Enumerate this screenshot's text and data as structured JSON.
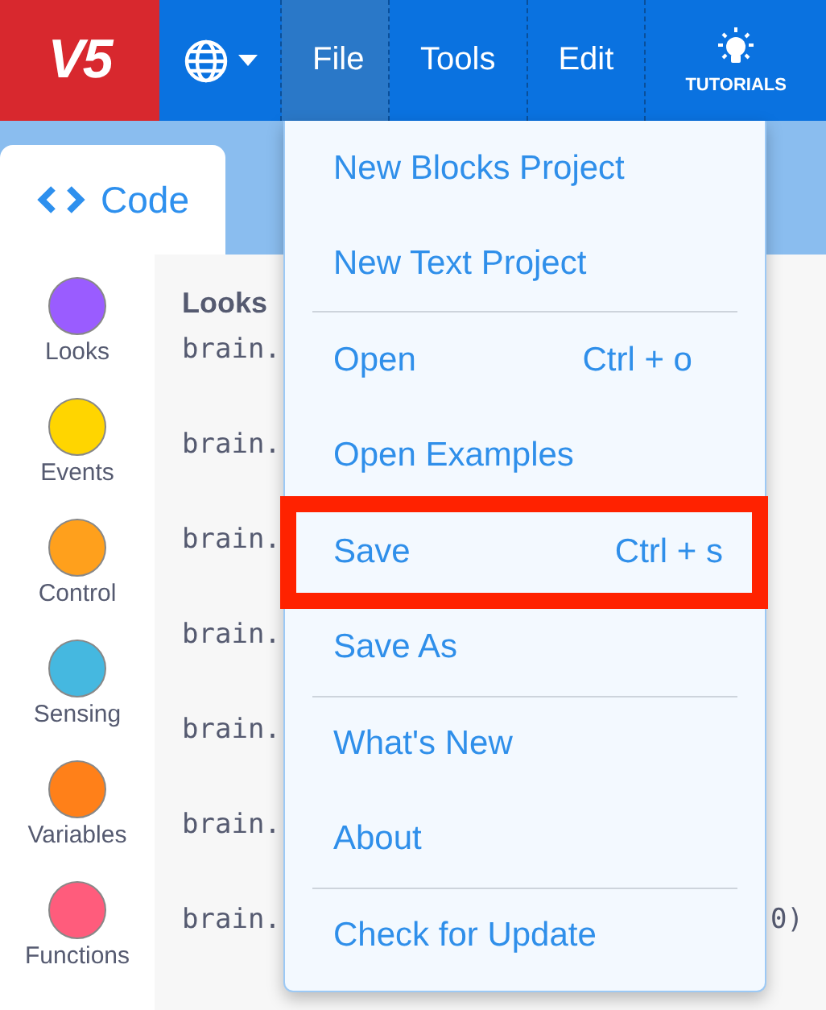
{
  "topbar": {
    "logo": "V5",
    "menus": [
      {
        "label": "File",
        "selected": true
      },
      {
        "label": "Tools",
        "selected": false
      },
      {
        "label": "Edit",
        "selected": false
      }
    ],
    "tutorials": "TUTORIALS"
  },
  "tabs": [
    {
      "label": "Code",
      "selected": true
    }
  ],
  "categories": [
    {
      "label": "Looks",
      "color": "#9a5cff"
    },
    {
      "label": "Events",
      "color": "#ffd500"
    },
    {
      "label": "Control",
      "color": "#ffa01c"
    },
    {
      "label": "Sensing",
      "color": "#45b8e0"
    },
    {
      "label": "Variables",
      "color": "#ff8019"
    },
    {
      "label": "Functions",
      "color": "#ff5c7c"
    }
  ],
  "code": {
    "heading": "Looks",
    "lines": [
      {
        "text": "brain."
      },
      {
        "text": "brain."
      },
      {
        "text": "brain."
      },
      {
        "text": "brain."
      },
      {
        "text": "brain."
      },
      {
        "text": "brain."
      },
      {
        "text": "brain.",
        "tail": "0)"
      }
    ]
  },
  "file_menu": [
    {
      "label": "New Blocks Project",
      "highlighted": false
    },
    {
      "label": "New Text Project",
      "highlighted": false,
      "divider": true
    },
    {
      "label": "Open",
      "shortcut": "Ctrl + o",
      "highlighted": false
    },
    {
      "label": "Open Examples",
      "highlighted": false
    },
    {
      "label": "Save",
      "shortcut": "Ctrl + s",
      "highlighted": true
    },
    {
      "label": "Save As",
      "highlighted": false,
      "divider": true
    },
    {
      "label": "What's New",
      "highlighted": false
    },
    {
      "label": "About",
      "highlighted": false,
      "divider": true
    },
    {
      "label": "Check for Update",
      "highlighted": false
    }
  ]
}
